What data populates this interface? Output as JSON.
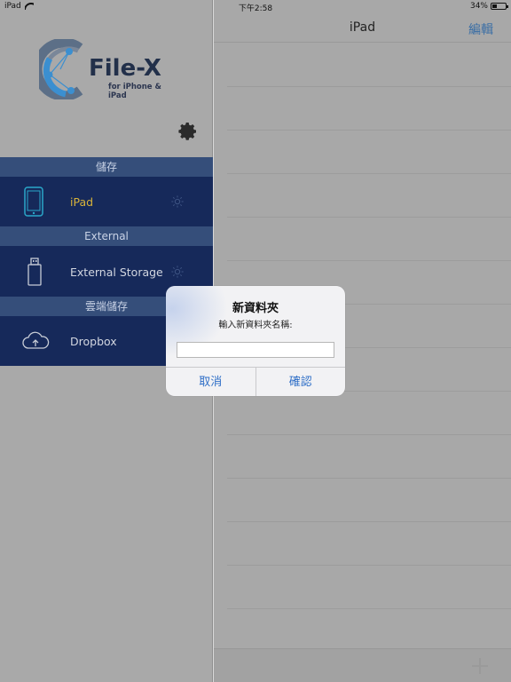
{
  "status_bar": {
    "device": "iPad",
    "time": "下午2:58",
    "battery": "34%",
    "battery_level": 0.34
  },
  "sidebar": {
    "logo": {
      "title": "File-X",
      "subtitle": "for iPhone & iPad"
    },
    "sections": [
      {
        "header": "儲存",
        "item": {
          "label": "iPad",
          "icon": "ipad-icon",
          "active": true
        }
      },
      {
        "header": "External",
        "item": {
          "label": "External Storage",
          "icon": "usb-drive-icon",
          "active": false
        }
      },
      {
        "header": "雲端儲存",
        "item": {
          "label": "Dropbox",
          "icon": "cloud-upload-icon",
          "active": false
        }
      }
    ]
  },
  "main": {
    "title": "iPad",
    "edit_label": "編輯"
  },
  "dialog": {
    "title": "新資料夾",
    "message": "輸入新資料夾名稱:",
    "input_value": "",
    "cancel_label": "取消",
    "confirm_label": "確認"
  },
  "colors": {
    "accent": "#2f6fc7",
    "active_item": "#d8b33a",
    "sidebar_row": "#16295a",
    "section_header": "#354e7a",
    "logo_text": "#22304a"
  }
}
